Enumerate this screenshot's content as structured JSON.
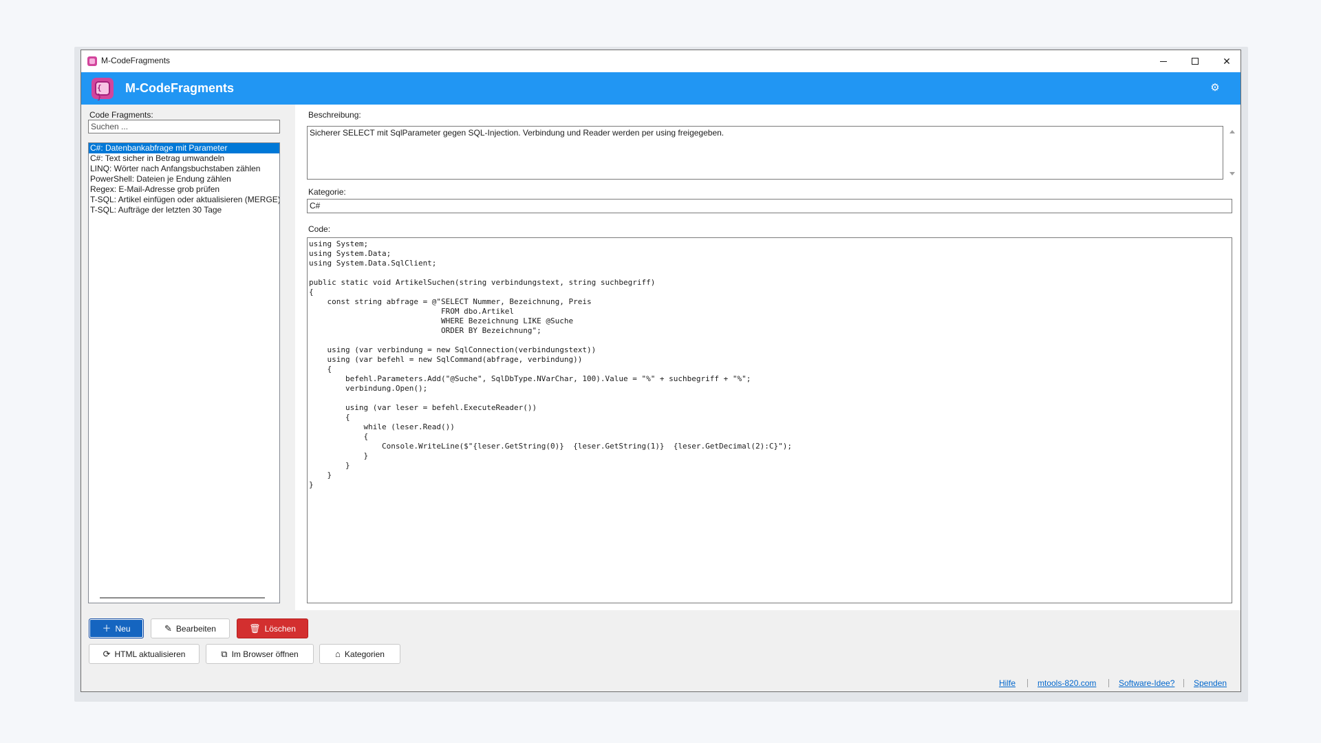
{
  "window": {
    "title": "M-CodeFragments",
    "controls": {
      "minimize": "minimize",
      "maximize": "maximize",
      "close": "✕"
    }
  },
  "header": {
    "app_name": "M-CodeFragments",
    "settings_icon": "gear-icon",
    "accent_color": "#2196f3"
  },
  "sidebar": {
    "label": "Code Fragments:",
    "search_placeholder": "Suchen ...",
    "items": [
      {
        "label": "C#: Datenbankabfrage mit Parameter",
        "selected": true
      },
      {
        "label": "C#: Text sicher in Betrag umwandeln",
        "selected": false
      },
      {
        "label": "LINQ: Wörter nach Anfangsbuchstaben zählen",
        "selected": false
      },
      {
        "label": "PowerShell: Dateien je Endung zählen",
        "selected": false
      },
      {
        "label": "Regex: E-Mail-Adresse grob prüfen",
        "selected": false
      },
      {
        "label": "T-SQL: Artikel einfügen oder aktualisieren (MERGE)",
        "selected": false
      },
      {
        "label": "T-SQL: Aufträge der letzten 30 Tage",
        "selected": false
      }
    ]
  },
  "detail": {
    "description_label": "Beschreibung:",
    "description_value": "Sicherer SELECT mit SqlParameter gegen SQL-Injection. Verbindung und Reader werden per using freigegeben.",
    "category_label": "Kategorie:",
    "category_value": "C#",
    "code_label": "Code:",
    "code_value": "using System;\nusing System.Data;\nusing System.Data.SqlClient;\n\npublic static void ArtikelSuchen(string verbindungstext, string suchbegriff)\n{\n    const string abfrage = @\"SELECT Nummer, Bezeichnung, Preis\n                             FROM dbo.Artikel\n                             WHERE Bezeichnung LIKE @Suche\n                             ORDER BY Bezeichnung\";\n\n    using (var verbindung = new SqlConnection(verbindungstext))\n    using (var befehl = new SqlCommand(abfrage, verbindung))\n    {\n        befehl.Parameters.Add(\"@Suche\", SqlDbType.NVarChar, 100).Value = \"%\" + suchbegriff + \"%\";\n        verbindung.Open();\n\n        using (var leser = befehl.ExecuteReader())\n        {\n            while (leser.Read())\n            {\n                Console.WriteLine($\"{leser.GetString(0)}  {leser.GetString(1)}  {leser.GetDecimal(2):C}\");\n            }\n        }\n    }\n}"
  },
  "actions": {
    "new": "Neu",
    "edit": "Bearbeiten",
    "delete": "Löschen",
    "refresh_html": "HTML aktualisieren",
    "open_browser": "Im Browser öffnen",
    "categories": "Kategorien",
    "colors": {
      "primary": "#1565c0",
      "danger": "#d32f2f"
    }
  },
  "footer": {
    "links": [
      "Hilfe",
      "mtools-820.com",
      "Software-Idee?",
      "Spenden"
    ]
  }
}
